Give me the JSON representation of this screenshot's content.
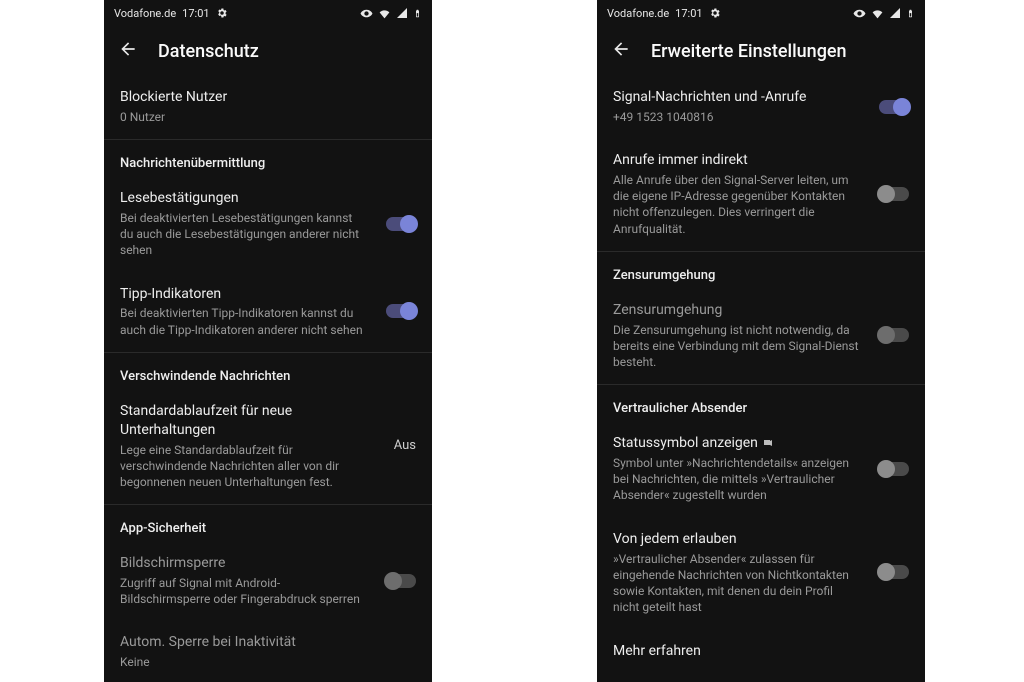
{
  "statusbar": {
    "carrier": "Vodafone.de",
    "time": "17:01"
  },
  "left": {
    "title": "Datenschutz",
    "blocked": {
      "title": "Blockierte Nutzer",
      "subtitle": "0 Nutzer"
    },
    "section_messages": "Nachrichtenübermittlung",
    "read_receipts": {
      "title": "Lesebestätigungen",
      "desc": "Bei deaktivierten Lesebestätigungen kannst du auch die Lesebestätigungen anderer nicht sehen"
    },
    "typing": {
      "title": "Tipp-Indikatoren",
      "desc": "Bei deaktivierten Tipp-Indikatoren kannst du auch die Tipp-Indikatoren anderer nicht sehen"
    },
    "section_disappear": "Verschwindende Nachrichten",
    "default_timer": {
      "title": "Standardablaufzeit für neue Unterhaltungen",
      "desc": "Lege eine Standardablaufzeit für verschwindende Nachrichten aller von dir begonnenen neuen Unterhaltungen fest.",
      "value": "Aus"
    },
    "section_app": "App-Sicherheit",
    "screen_lock": {
      "title": "Bildschirmsperre",
      "desc": "Zugriff auf Signal mit Android-Bildschirmsperre oder Fingerabdruck sperren"
    },
    "auto_lock": {
      "title": "Autom. Sperre bei Inaktivität",
      "desc": "Keine"
    }
  },
  "right": {
    "title": "Erweiterte Einstellungen",
    "signal_msgs": {
      "title": "Signal-Nachrichten und -Anrufe",
      "desc": "+49 1523 1040816"
    },
    "relay": {
      "title": "Anrufe immer indirekt",
      "desc": "Alle Anrufe über den Signal-Server leiten, um die eigene IP-Adresse gegenüber Kontakten nicht offenzulegen. Dies verringert die Anrufqualität."
    },
    "section_censor": "Zensurumgehung",
    "censor": {
      "title": "Zensurumgehung",
      "desc": "Die Zensurumgehung ist nicht notwendig, da bereits eine Verbindung mit dem Signal-Dienst besteht."
    },
    "section_sealed": "Vertraulicher Absender",
    "status_symbol": {
      "title": "Statussymbol anzeigen",
      "desc": "Symbol unter »Nachrichtendetails« anzeigen bei Nachrichten, die mittels »Vertraulicher Absender« zugestellt wurden"
    },
    "allow_any": {
      "title": "Von jedem erlauben",
      "desc": "»Vertraulicher Absender« zulassen für eingehende Nachrichten von Nichtkontakten sowie Kontakten, mit denen du dein Profil nicht geteilt hast"
    },
    "learn_more": "Mehr erfahren"
  }
}
